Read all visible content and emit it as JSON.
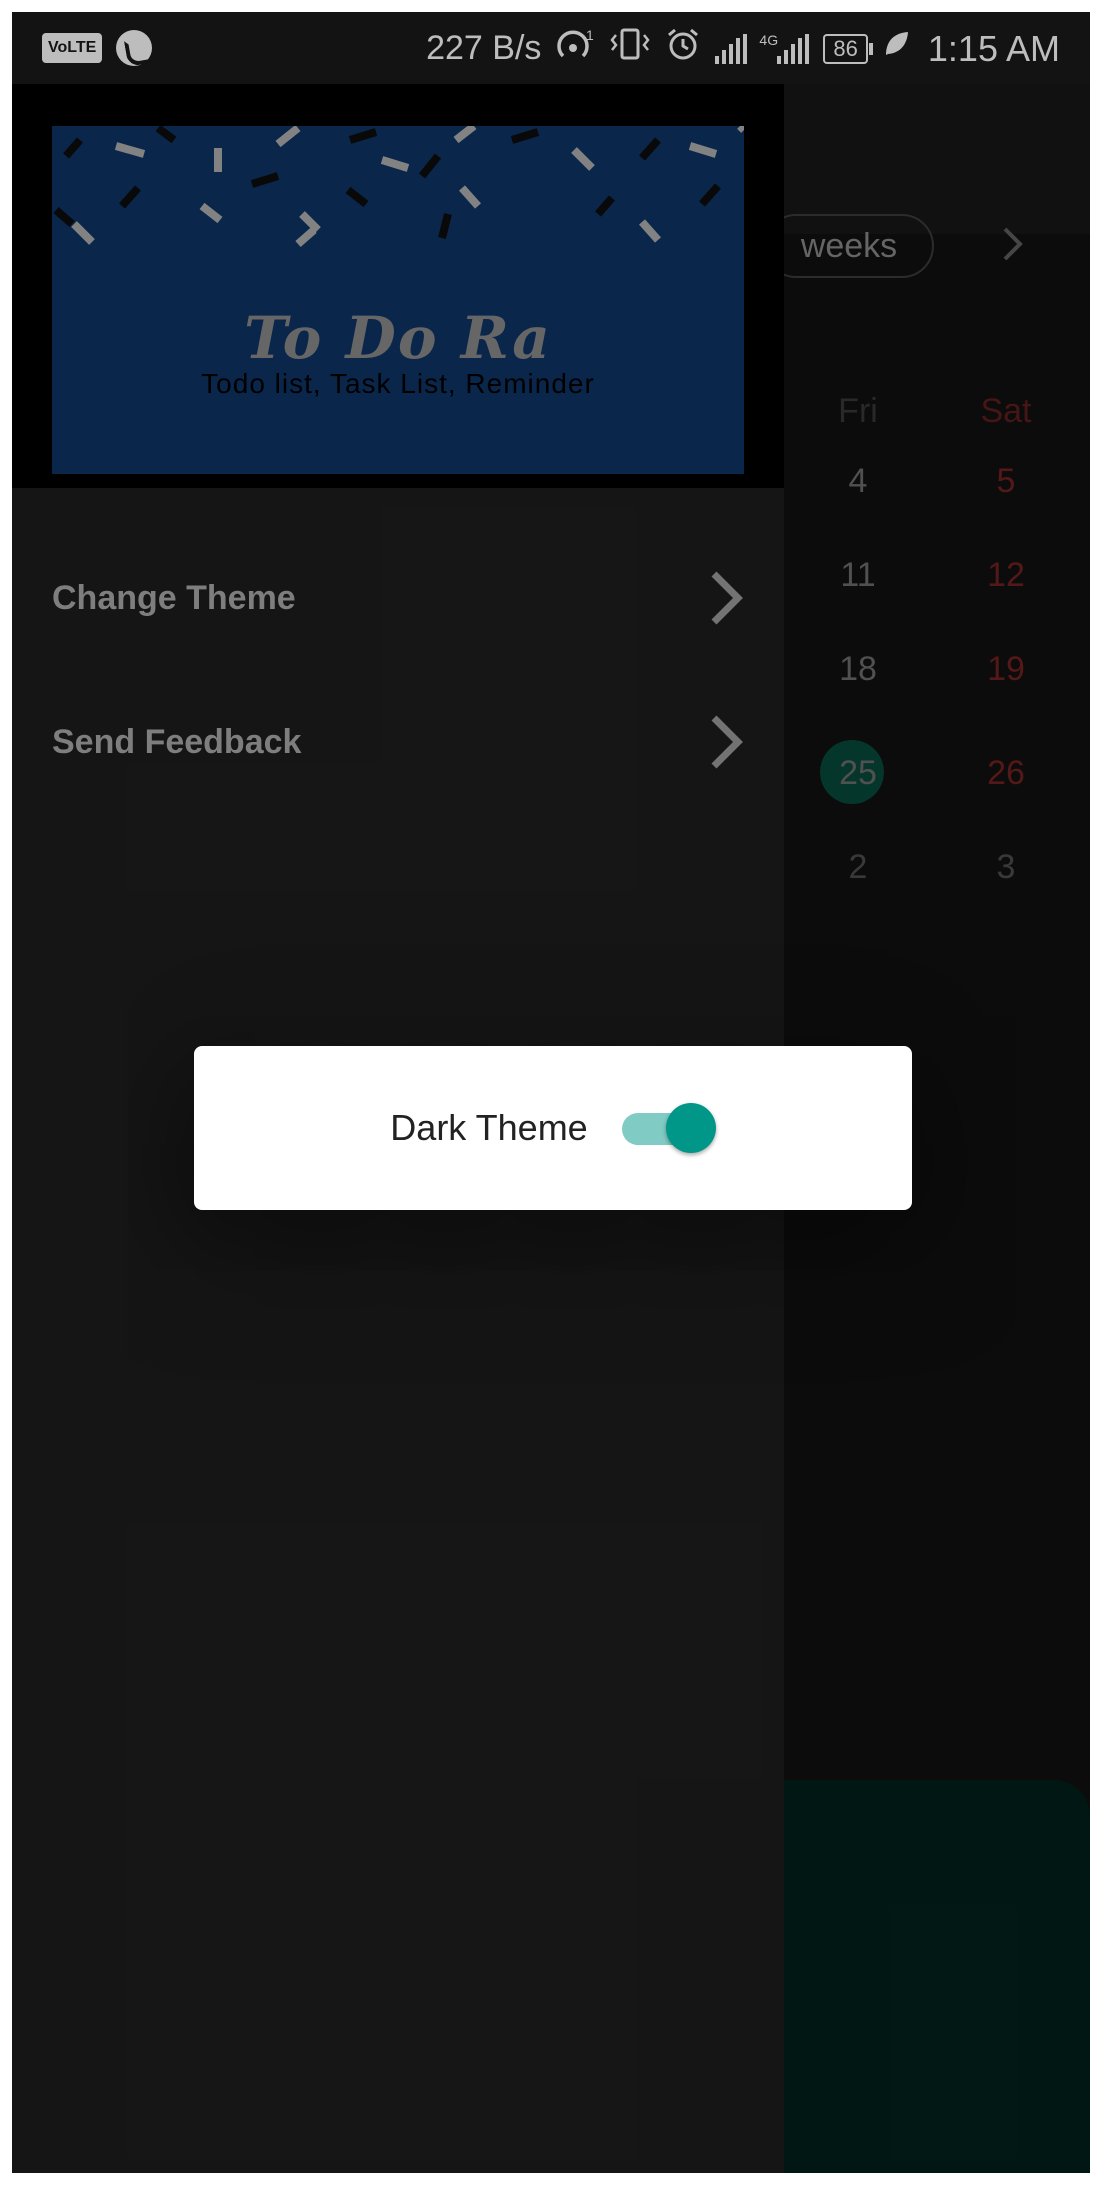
{
  "status_bar": {
    "volte": "VoLTE",
    "network_speed": "227 B/s",
    "hotspot_badge": "1",
    "network_type": "4G",
    "battery": "86",
    "time": "1:15 AM",
    "icons": [
      "call-icon",
      "hotspot-icon",
      "vibrate-icon",
      "alarm-icon",
      "signal-icon",
      "battery-icon",
      "leaf-icon"
    ]
  },
  "background_calendar": {
    "view_label": "weeks",
    "headers": {
      "fri": "Fri",
      "sat": "Sat"
    },
    "rows": [
      {
        "fri": "4",
        "sat": "5"
      },
      {
        "fri": "11",
        "sat": "12"
      },
      {
        "fri": "18",
        "sat": "19"
      },
      {
        "fri": "25",
        "sat": "26"
      },
      {
        "fri": "2",
        "sat": "3"
      }
    ],
    "selected_day": "25"
  },
  "drawer": {
    "banner": {
      "title": "To Do Ra",
      "subtitle": "Todo list, Task List, Reminder"
    },
    "menu": [
      {
        "label": "Change Theme"
      },
      {
        "label": "Send Feedback"
      }
    ]
  },
  "dialog": {
    "label": "Dark Theme",
    "toggle_on": true
  },
  "colors": {
    "accent": "#009688",
    "accent_light": "#80cbc4",
    "banner_bg": "#0b2a50",
    "drawer_bg": "#171717"
  }
}
